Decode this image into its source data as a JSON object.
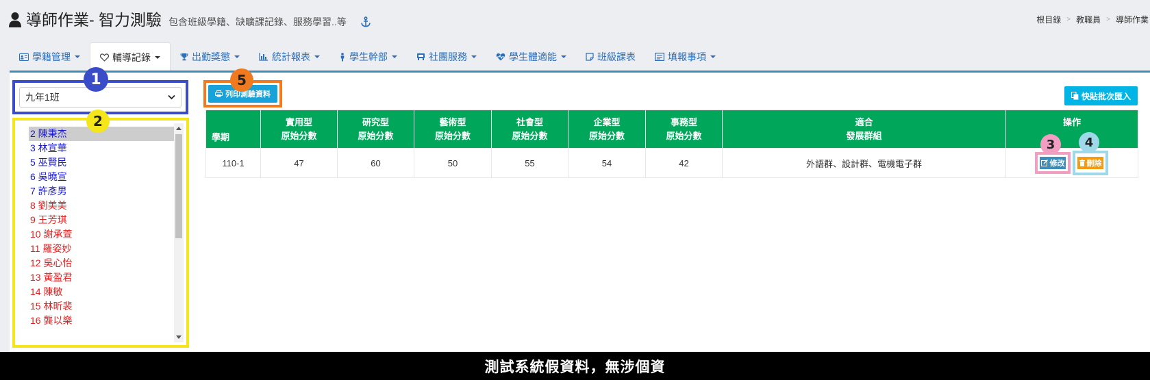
{
  "header": {
    "title": "導師作業- 智力測驗",
    "subtitle": "包含班級學籍、缺曠課記錄、服務學習..等",
    "icons": [
      "user-icon",
      "anchor-icon"
    ],
    "breadcrumb": [
      "根目錄",
      "教職員",
      "導師作業"
    ]
  },
  "tabs": [
    {
      "label": "學籍管理",
      "icon": "id-card-icon",
      "active": false
    },
    {
      "label": "輔導記錄",
      "icon": "heart-icon",
      "active": true
    },
    {
      "label": "出勤獎懲",
      "icon": "trophy-icon",
      "active": false
    },
    {
      "label": "統計報表",
      "icon": "bar-chart-icon",
      "active": false
    },
    {
      "label": "學生幹部",
      "icon": "person-icon",
      "active": false
    },
    {
      "label": "社團服務",
      "icon": "group-icon",
      "active": false
    },
    {
      "label": "學生體適能",
      "icon": "heartbeat-icon",
      "active": false
    },
    {
      "label": "班級課表",
      "icon": "note-icon",
      "active": false
    },
    {
      "label": "填報事項",
      "icon": "form-icon",
      "active": false
    }
  ],
  "class_select": {
    "value": "九年1班"
  },
  "students": [
    {
      "label": "2 陳秉杰",
      "color": "blue",
      "selected": true
    },
    {
      "label": "3 林宣華",
      "color": "blue",
      "selected": false
    },
    {
      "label": "5 巫賢民",
      "color": "blue",
      "selected": false
    },
    {
      "label": "6 吳曉宣",
      "color": "blue",
      "selected": false
    },
    {
      "label": "7 許彥男",
      "color": "blue",
      "selected": false
    },
    {
      "label": "8 劉美美",
      "color": "red",
      "selected": false
    },
    {
      "label": "9 王芳琪",
      "color": "red",
      "selected": false
    },
    {
      "label": "10 謝承萱",
      "color": "red",
      "selected": false
    },
    {
      "label": "11 羅姿妙",
      "color": "red",
      "selected": false
    },
    {
      "label": "12 吳心怡",
      "color": "red",
      "selected": false
    },
    {
      "label": "13 黃盈君",
      "color": "red",
      "selected": false
    },
    {
      "label": "14 陳敏",
      "color": "red",
      "selected": false
    },
    {
      "label": "15 林昕裴",
      "color": "red",
      "selected": false
    },
    {
      "label": "16 龔以樂",
      "color": "red",
      "selected": false
    }
  ],
  "buttons": {
    "print": "列印測驗資料",
    "paste_import": "快貼批次匯入",
    "edit": "修改",
    "delete": "刪除"
  },
  "table": {
    "headers": [
      {
        "l1": "",
        "l2": "學期"
      },
      {
        "l1": "實用型",
        "l2": "原始分數"
      },
      {
        "l1": "研究型",
        "l2": "原始分數"
      },
      {
        "l1": "藝術型",
        "l2": "原始分數"
      },
      {
        "l1": "社會型",
        "l2": "原始分數"
      },
      {
        "l1": "企業型",
        "l2": "原始分數"
      },
      {
        "l1": "事務型",
        "l2": "原始分數"
      },
      {
        "l1": "適合",
        "l2": "發展群組"
      },
      {
        "l1": "操作",
        "l2": ""
      }
    ],
    "rows": [
      {
        "term": "110-1",
        "realistic": "47",
        "investigative": "60",
        "artistic": "50",
        "social": "55",
        "enterprising": "54",
        "conventional": "42",
        "groups": "外語群、設計群、電機電子群"
      }
    ]
  },
  "badges": [
    "1",
    "2",
    "3",
    "4",
    "5"
  ],
  "footer": {
    "text": "測試系統假資料，無涉個資"
  },
  "colors": {
    "tab_link": "#2a6fbb",
    "table_header": "#00a65a",
    "print_btn": "#17a2d9",
    "edit_btn": "#3c8dbc",
    "delete_btn": "#f39c12",
    "badge1": "#3b4cc8",
    "badge2": "#f5e51b",
    "badge3": "#f19ec2",
    "badge4": "#9fd8e8",
    "badge5": "#f07a20"
  }
}
